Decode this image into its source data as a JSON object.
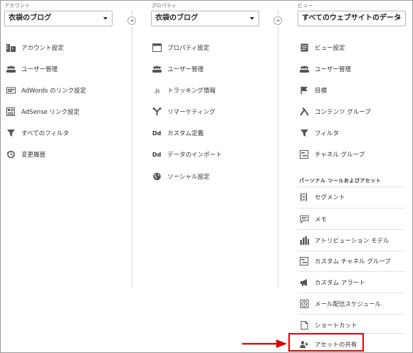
{
  "account": {
    "label": "アカウント",
    "selected": "衣袋のブログ",
    "items": [
      {
        "label": "アカウント設定",
        "icon": "building-icon"
      },
      {
        "label": "ユーザー管理",
        "icon": "users-icon"
      },
      {
        "label": "AdWords のリンク設定",
        "icon": "adwords-icon"
      },
      {
        "label": "AdSense リンク設定",
        "icon": "adsense-icon"
      },
      {
        "label": "すべてのフィルタ",
        "icon": "filter-icon"
      },
      {
        "label": "変更履歴",
        "icon": "history-icon"
      }
    ]
  },
  "property": {
    "label": "プロパティ",
    "selected": "衣袋のブログ",
    "items": [
      {
        "label": "プロパティ設定",
        "icon": "window-icon"
      },
      {
        "label": "ユーザー管理",
        "icon": "users-icon"
      },
      {
        "label": "トラッキング情報",
        "icon": "js-icon",
        "glyph": ".js"
      },
      {
        "label": "リマーケティング",
        "icon": "remarketing-icon"
      },
      {
        "label": "カスタム定義",
        "icon": "dd-icon",
        "glyph": "Dd"
      },
      {
        "label": "データのインポート",
        "icon": "dd-icon",
        "glyph": "Dd"
      },
      {
        "label": "ソーシャル設定",
        "icon": "globe-icon"
      }
    ]
  },
  "view": {
    "label": "ビュー",
    "selected": "すべてのウェブサイトのデータ",
    "items": [
      {
        "label": "ビュー設定",
        "icon": "document-icon"
      },
      {
        "label": "ユーザー管理",
        "icon": "users-icon"
      },
      {
        "label": "目標",
        "icon": "flag-icon"
      },
      {
        "label": "コンテンツ グループ",
        "icon": "content-group-icon"
      },
      {
        "label": "フィルタ",
        "icon": "filter-icon"
      },
      {
        "label": "チャネル グループ",
        "icon": "channel-icon"
      }
    ],
    "section_title": "パーソナル ツールおよびアセット",
    "assets": [
      {
        "label": "セグメント",
        "icon": "segment-icon"
      },
      {
        "label": "メモ",
        "icon": "memo-icon"
      },
      {
        "label": "アトリビューション モデル",
        "icon": "bar-chart-icon"
      },
      {
        "label": "カスタム チャネル グループ",
        "icon": "channel-icon"
      },
      {
        "label": "カスタム アラート",
        "icon": "megaphone-icon"
      },
      {
        "label": "メール配信スケジュール",
        "icon": "clock-icon"
      },
      {
        "label": "ショートカット",
        "icon": "doc-icon"
      },
      {
        "label": "アセットの共有",
        "icon": "add-user-icon"
      }
    ]
  },
  "colors": {
    "highlight": "#e00000",
    "divider": "#d6d6d6"
  }
}
